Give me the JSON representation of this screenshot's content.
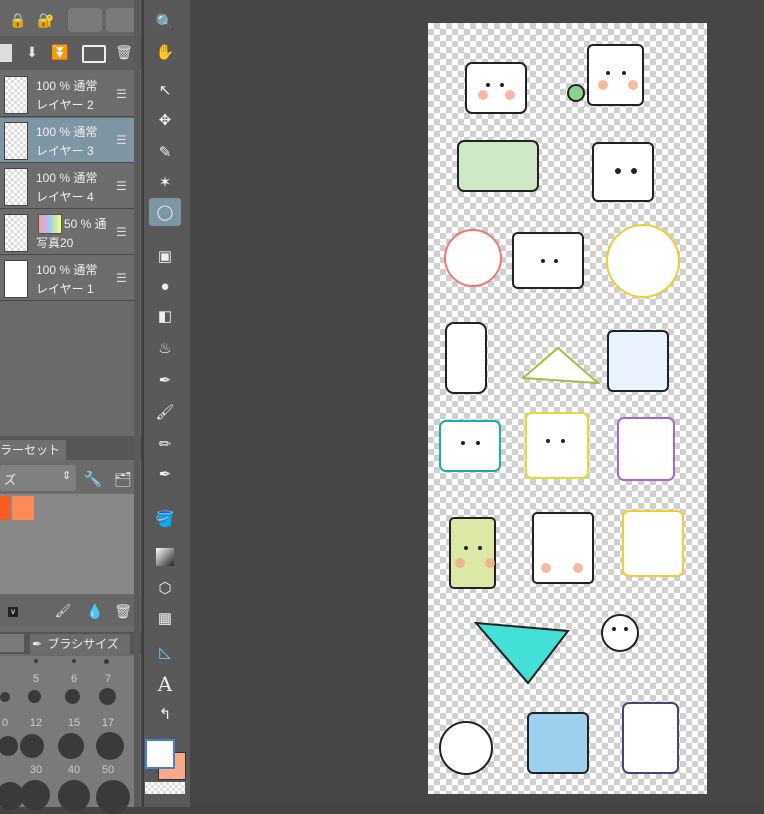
{
  "layers": [
    {
      "opacity": "100 % 通常",
      "name": "レイヤー 2",
      "selected": false
    },
    {
      "opacity": "100 % 通常",
      "name": "レイヤー 3",
      "selected": true
    },
    {
      "opacity": "100 % 通常",
      "name": "レイヤー 4",
      "selected": false
    },
    {
      "opacity": "50 % 通",
      "name": "写真20",
      "selected": false
    },
    {
      "opacity": "100 % 通常",
      "name": "レイヤー 1",
      "selected": false
    }
  ],
  "colorset": {
    "tab_label": "ラーセット",
    "dropdown_value": "ズ"
  },
  "brush": {
    "tab_label": "ブラシサイズ",
    "sizes_row1": [
      "5",
      "6",
      "7"
    ],
    "sizes_row2": [
      "0",
      "12",
      "15",
      "17"
    ],
    "sizes_row3": [
      "30",
      "40",
      "50"
    ]
  },
  "colors": {
    "main": "#ffffff",
    "sub": "#f7a98a",
    "swatch1": "#ff5a1f",
    "swatch2": "#ff8a55",
    "accent": "#7e95a3"
  },
  "tools": [
    "zoom-icon",
    "hand-icon",
    "object-icon",
    "move-icon",
    "eyedropper-icon",
    "wand-icon",
    "lasso-icon",
    "fill-icon",
    "blur-icon",
    "eraser-icon",
    "airbrush-icon",
    "pen-icon",
    "brush-icon",
    "pencil-icon",
    "ink-icon",
    "bucket-icon",
    "gradient-icon",
    "figure-icon",
    "frame-icon",
    "ruler-icon",
    "text-icon",
    "balloon-icon"
  ]
}
